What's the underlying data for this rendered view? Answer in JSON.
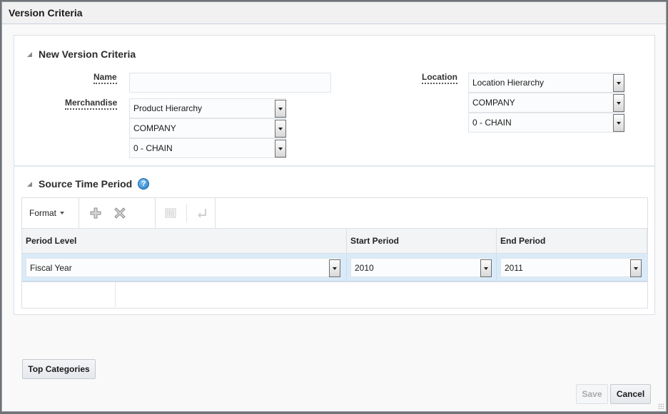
{
  "dialog": {
    "title": "Version Criteria"
  },
  "new_version_criteria": {
    "header": "New Version Criteria",
    "name": {
      "label": "Name",
      "value": ""
    },
    "merchandise": {
      "label": "Merchandise",
      "hierarchy": "Product Hierarchy",
      "level": "COMPANY",
      "member": "0 - CHAIN"
    },
    "location": {
      "label": "Location",
      "hierarchy": "Location Hierarchy",
      "level": "COMPANY",
      "member": "0 - CHAIN"
    }
  },
  "source_time_period": {
    "header": "Source Time Period",
    "help_icon": "help-icon",
    "toolbar": {
      "format_label": "Format",
      "icons": [
        "add-icon",
        "delete-icon",
        "columns-icon",
        "enter-icon"
      ]
    },
    "columns": [
      "Period Level",
      "Start Period",
      "End Period"
    ],
    "rows": [
      {
        "period_level": "Fiscal Year",
        "start_period": "2010",
        "end_period": "2011"
      }
    ]
  },
  "buttons": {
    "top_categories": "Top Categories",
    "save": "Save",
    "cancel": "Cancel"
  }
}
